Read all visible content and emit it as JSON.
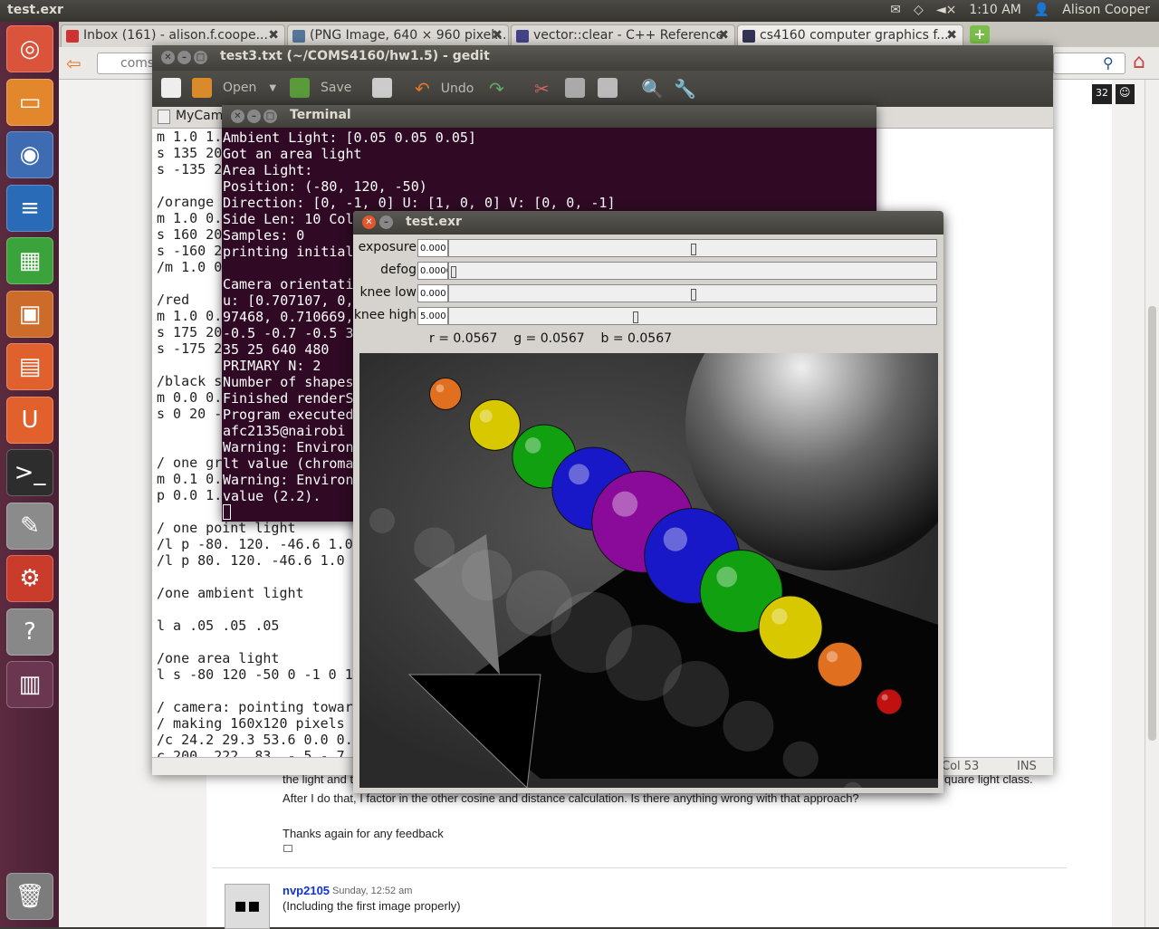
{
  "topbar": {
    "app_title": "test.exr",
    "time": "1:10 AM",
    "user": "Alison Cooper"
  },
  "launcher": [
    {
      "name": "ubuntu-home-icon",
      "bg": "#d9543a"
    },
    {
      "name": "files-icon",
      "bg": "#e3872d"
    },
    {
      "name": "firefox-icon",
      "bg": "#3d6cb3"
    },
    {
      "name": "writer-icon",
      "bg": "#2a6bb7"
    },
    {
      "name": "calc-icon",
      "bg": "#3ba33b"
    },
    {
      "name": "impress-icon",
      "bg": "#cc6b2a"
    },
    {
      "name": "software-center-icon",
      "bg": "#e0602e"
    },
    {
      "name": "ubuntu-one-icon",
      "bg": "#e2602c"
    },
    {
      "name": "terminal-icon",
      "bg": "#2d2d2d"
    },
    {
      "name": "gedit-icon",
      "bg": "#8b8b8b"
    },
    {
      "name": "settings-icon",
      "bg": "#c93c2c"
    },
    {
      "name": "help-icon",
      "bg": "#888888"
    },
    {
      "name": "workspaces-icon",
      "bg": "#6b3650"
    },
    {
      "name": "trash-icon",
      "bg": "#7c7c7c"
    }
  ],
  "browser": {
    "tabs": [
      "Inbox (161) - alison.f.coope...",
      "(PNG Image, 640 × 960 pixel...",
      "vector::clear - C++ Reference",
      "cs4160 computer graphics f..."
    ],
    "url": "coms",
    "webpage": {
      "text1": "the light and t",
      "text1_tail": "quare light class.",
      "text2": "After I do that, I factor in the other cosine and distance calculation. Is there anything wrong with that approach?",
      "text3": "Thanks again for any feedback",
      "author": "nvp2105",
      "date": "Sunday, 12:52 am",
      "comment": "(Including the first image properly)",
      "badge": "32"
    }
  },
  "gedit": {
    "title": "test3.txt (~/COMS4160/hw1.5) - gedit",
    "toolbar": {
      "open": "Open",
      "save": "Save",
      "undo": "Undo"
    },
    "tab": "MyCam",
    "status_col": "Col 53",
    "status_ins": "INS",
    "lines": [
      "m 1.0 1.",
      "s 135 20",
      "s -135 2",
      "",
      "/orange ",
      "m 1.0 0.",
      "s 160 20",
      "s -160 2",
      "/m 1.0 0",
      "",
      "/red",
      "m 1.0 0.",
      "s 175 20",
      "s -175 2",
      "",
      "/black s",
      "m 0.0 0.",
      "s 0 20 -",
      "",
      "",
      "/ one gr",
      "m 0.1 0.",
      "p 0.0 1.",
      "",
      "/ one point light",
      "/l p -80. 120. -46.6 1.0",
      "/l p 80. 120. -46.6 1.0",
      "",
      "/one ambient light",
      "",
      "l a .05 .05 .05",
      "",
      "/one area light",
      "l s -80 120 -50 0 -1 0 1",
      "",
      "/ camera: pointing towar",
      "/ making 160x120 pixels",
      "/c 24.2 29.3 53.6 0.0 0.",
      "c 200. 222. 83. -.5 -.7"
    ]
  },
  "terminal": {
    "title": "Terminal",
    "lines": [
      "Ambient Light: [0.05 0.05 0.05]",
      "Got an area light",
      "Area Light:",
      "Position: (-80, 120, -50)",
      "Direction: [0, -1, 0] U: [1, 0, 0] V: [0, 0, -1]",
      "Side Len: 10 Col",
      "Samples: 0",
      "printing initial",
      "",
      "Camera orientati",
      "u: [0.707107, 0,",
      "97468, 0.710669,",
      "-0.5 -0.7 -0.5 3",
      "35 25 640 480",
      "PRIMARY N: 2",
      "Number of shapes",
      "Finished renderS",
      "Program executed",
      "afc2135@nairobi ",
      "Warning: Environ",
      "lt value (chroma",
      "Warning: Environ",
      "value (2.2)."
    ]
  },
  "exr": {
    "title": "test.exr",
    "sliders": [
      {
        "label": "exposure",
        "value": "0.000",
        "pos": 0.5
      },
      {
        "label": "defog",
        "value": "0.0000",
        "pos": 0.0
      },
      {
        "label": "knee low",
        "value": "0.000",
        "pos": 0.5
      },
      {
        "label": "knee high",
        "value": "5.000",
        "pos": 0.38
      }
    ],
    "pixel": {
      "r": "r = 0.0567",
      "g": "g = 0.0567",
      "b": "b = 0.0567"
    },
    "spheres": [
      {
        "color": "#e07020",
        "size": 0.05
      },
      {
        "color": "#d8c800",
        "size": 0.08
      },
      {
        "color": "#10a010",
        "size": 0.1
      },
      {
        "color": "#1818c8",
        "size": 0.13
      },
      {
        "color": "#8a0a9a",
        "size": 0.16
      },
      {
        "color": "#1818c8",
        "size": 0.15
      },
      {
        "color": "#10a010",
        "size": 0.13
      },
      {
        "color": "#d8c800",
        "size": 0.1
      },
      {
        "color": "#e07020",
        "size": 0.07
      },
      {
        "color": "#c01010",
        "size": 0.04
      }
    ]
  }
}
